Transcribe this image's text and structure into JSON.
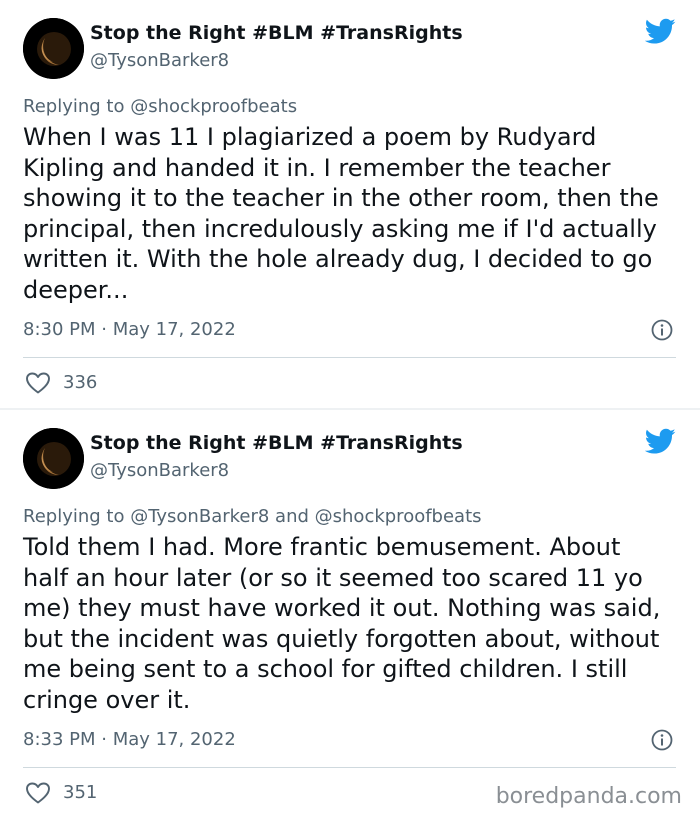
{
  "accent_color": "#1d9bf0",
  "tweets": [
    {
      "display_name": "Stop the Right #BLM #TransRights",
      "handle": "@TysonBarker8",
      "replying_to": "Replying to @shockproofbeats",
      "text": "When I was 11 I plagiarized a poem by Rudyard Kipling and handed it in. I remember the teacher showing it to the teacher in the other room, then the principal, then incredulously asking me if I'd actually written it. With the hole already dug, I decided to go deeper...",
      "timestamp": "8:30 PM · May 17, 2022",
      "like_count": "336",
      "icons": {
        "avatar": "moon-avatar",
        "brand": "twitter-bird-icon",
        "info": "info-icon",
        "like": "heart-icon"
      }
    },
    {
      "display_name": "Stop the Right #BLM #TransRights",
      "handle": "@TysonBarker8",
      "replying_to": "Replying to @TysonBarker8 and @shockproofbeats",
      "text": "Told them I had. More frantic bemusement. About half an hour later (or so it seemed too scared 11 yo me) they must have worked it out. Nothing was said, but the incident was quietly forgotten about, without me being sent to a school for gifted children. I still cringe over it.",
      "timestamp": "8:33 PM · May 17, 2022",
      "like_count": "351",
      "icons": {
        "avatar": "moon-avatar",
        "brand": "twitter-bird-icon",
        "info": "info-icon",
        "like": "heart-icon"
      }
    }
  ],
  "watermark": "boredpanda.com"
}
